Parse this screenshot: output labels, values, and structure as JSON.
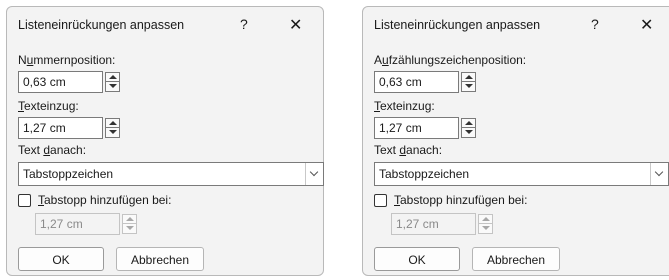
{
  "dialogs": [
    {
      "title": "Listeneinrückungen anpassen",
      "help_glyph": "?",
      "close_glyph": "✕",
      "position_label": "Nummernposition:",
      "position_accesskey": "u",
      "position_value": "0,63 cm",
      "indent_label": "Texteinzug:",
      "indent_value": "1,27 cm",
      "follow_label": "Text danach:",
      "follow_value": "Tabstoppzeichen",
      "tabstop_label": "Tabstopp hinzufügen bei:",
      "tabstop_checked": false,
      "tabstop_value": "1,27 cm",
      "ok_label": "OK",
      "cancel_label": "Abbrechen"
    },
    {
      "title": "Listeneinrückungen anpassen",
      "help_glyph": "?",
      "close_glyph": "✕",
      "position_label": "Aufzählungszeichenposition:",
      "position_accesskey": "u",
      "position_value": "0,63 cm",
      "indent_label": "Texteinzug:",
      "indent_value": "1,27 cm",
      "follow_label": "Text danach:",
      "follow_value": "Tabstoppzeichen",
      "tabstop_label": "Tabstopp hinzufügen bei:",
      "tabstop_checked": false,
      "tabstop_value": "1,27 cm",
      "ok_label": "OK",
      "cancel_label": "Abbrechen"
    }
  ]
}
